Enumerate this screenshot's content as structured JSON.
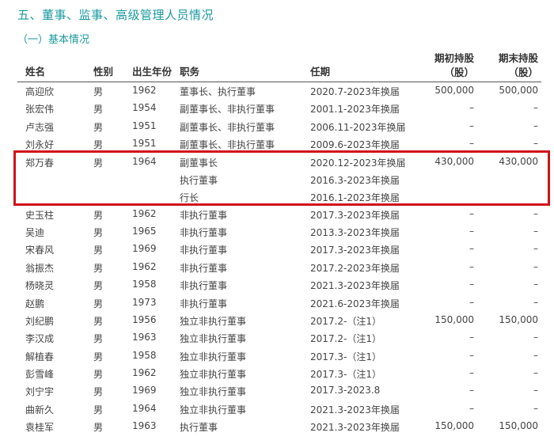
{
  "section_title": "五、董事、监事、高级管理人员情况",
  "subsection_title": "（一）基本情况",
  "headers": {
    "name": "姓名",
    "gender": "性别",
    "birth": "出生年份",
    "role": "职务",
    "term": "任期",
    "start_shares": "期初持股",
    "start_unit": "（股）",
    "end_shares": "期末持股",
    "end_unit": "（股）"
  },
  "rows": [
    {
      "name": "高迎欣",
      "gender": "男",
      "birth": "1962",
      "role": "董事长、执行董事",
      "term": "2020.7-2023年换届",
      "start": "500,000",
      "end": "500,000"
    },
    {
      "name": "张宏伟",
      "gender": "男",
      "birth": "1954",
      "role": "副董事长、非执行董事",
      "term": "2001.1-2023年换届",
      "start": "–",
      "end": "–"
    },
    {
      "name": "卢志强",
      "gender": "男",
      "birth": "1951",
      "role": "副董事长、非执行董事",
      "term": "2006.11-2023年换届",
      "start": "–",
      "end": "–"
    },
    {
      "name": "刘永好",
      "gender": "男",
      "birth": "1951",
      "role": "副董事长、非执行董事",
      "term": "2009.6-2023年换届",
      "start": "–",
      "end": "–"
    }
  ],
  "highlight_row": {
    "name": "郑万春",
    "gender": "男",
    "birth": "1964",
    "roles": [
      "副董事长",
      "执行董事",
      "行长"
    ],
    "terms": [
      "2020.12-2023年换届",
      "2016.3-2023年换届",
      "2016.1-2023年换届"
    ],
    "start": "430,000",
    "end": "430,000"
  },
  "rows_after": [
    {
      "name": "史玉柱",
      "gender": "男",
      "birth": "1962",
      "role": "非执行董事",
      "term": "2017.3-2023年换届",
      "start": "–",
      "end": "–"
    },
    {
      "name": "吴迪",
      "gender": "男",
      "birth": "1965",
      "role": "非执行董事",
      "term": "2013.3-2023年换届",
      "start": "–",
      "end": "–"
    },
    {
      "name": "宋春风",
      "gender": "男",
      "birth": "1969",
      "role": "非执行董事",
      "term": "2017.3-2023年换届",
      "start": "–",
      "end": "–"
    },
    {
      "name": "翁振杰",
      "gender": "男",
      "birth": "1962",
      "role": "非执行董事",
      "term": "2017.2-2023年换届",
      "start": "–",
      "end": "–"
    },
    {
      "name": "杨晓灵",
      "gender": "男",
      "birth": "1958",
      "role": "非执行董事",
      "term": "2021.3-2023年换届",
      "start": "–",
      "end": "–"
    },
    {
      "name": "赵鹏",
      "gender": "男",
      "birth": "1973",
      "role": "非执行董事",
      "term": "2021.6-2023年换届",
      "start": "–",
      "end": "–"
    },
    {
      "name": "刘纪鹏",
      "gender": "男",
      "birth": "1956",
      "role": "独立非执行董事",
      "term": "2017.2-（注1）",
      "start": "150,000",
      "end": "150,000"
    },
    {
      "name": "李汉成",
      "gender": "男",
      "birth": "1963",
      "role": "独立非执行董事",
      "term": "2017.2-（注1）",
      "start": "–",
      "end": "–"
    },
    {
      "name": "解植春",
      "gender": "男",
      "birth": "1958",
      "role": "独立非执行董事",
      "term": "2017.3-（注1）",
      "start": "–",
      "end": "–"
    },
    {
      "name": "彭雪峰",
      "gender": "男",
      "birth": "1962",
      "role": "独立非执行董事",
      "term": "2017.3-（注1）",
      "start": "–",
      "end": "–"
    },
    {
      "name": "刘宁宇",
      "gender": "男",
      "birth": "1969",
      "role": "独立非执行董事",
      "term": "2017.3-2023.8",
      "start": "–",
      "end": "–"
    },
    {
      "name": "曲新久",
      "gender": "男",
      "birth": "1964",
      "role": "独立非执行董事",
      "term": "2021.3-2023年换届",
      "start": "–",
      "end": "–"
    },
    {
      "name": "袁桂军",
      "gender": "男",
      "birth": "1963",
      "role": "执行董事",
      "term": "2021.3-2023年换届",
      "start": "150,000",
      "end": "150,000"
    }
  ],
  "colors": {
    "accent": "#1b9aa0",
    "highlight": "#d0121b"
  }
}
